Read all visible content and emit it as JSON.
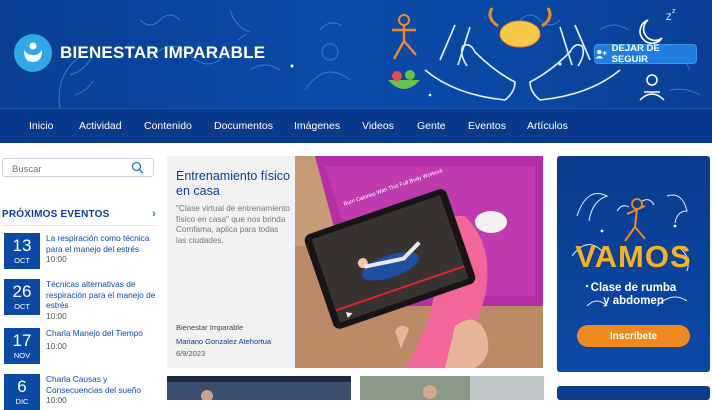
{
  "header": {
    "site_title": "BIENESTAR IMPARABLE",
    "follow_label": "DEJAR DE SEGUIR",
    "colors": {
      "banner": "#0a48a6",
      "nav": "#0a3a8c",
      "accent": "#1f7fe0"
    }
  },
  "nav": {
    "items": [
      "Inicio",
      "Actividad",
      "Contenido",
      "Documentos",
      "Imágenes",
      "Videos",
      "Gente",
      "Eventos",
      "Artículos"
    ]
  },
  "sidebar": {
    "search_placeholder": "Buscar",
    "events_heading": "PRÓXIMOS EVENTOS",
    "events": [
      {
        "day": "13",
        "month": "OCT",
        "title": "La respiración como técnica para el manejo del estrés",
        "time": "10:00"
      },
      {
        "day": "26",
        "month": "OCT",
        "title": "Técnicas alternativas de respiración para el manejo de estrés",
        "time": "10:00"
      },
      {
        "day": "17",
        "month": "NOV",
        "title": "Charla Manejo del Tiempo",
        "time": "10:00"
      },
      {
        "day": "6",
        "month": "DIC",
        "title": "Charla Causas y Consecuencias del sueño",
        "time": "10:00"
      }
    ]
  },
  "featured": {
    "title": "Entrenamiento físico en casa",
    "quote": "\"Clase virtual de entrenamiento físico en casa\" que nos brinda Comfama, aplica para todas las ciudades.",
    "source": "Bienestar Imparable",
    "author": "Mariano Gonzalez Atehortua",
    "date": "6/9/2023",
    "video_title": "Burn Calories With This Full Body Workout"
  },
  "promo": {
    "headline": "VAMOS",
    "subtitle_line1": "Clase de rumba",
    "subtitle_line2": "y abdomen",
    "button_label": "Inscríbete",
    "colors": {
      "headline": "#f5b21d",
      "button": "#f08a1e"
    }
  }
}
